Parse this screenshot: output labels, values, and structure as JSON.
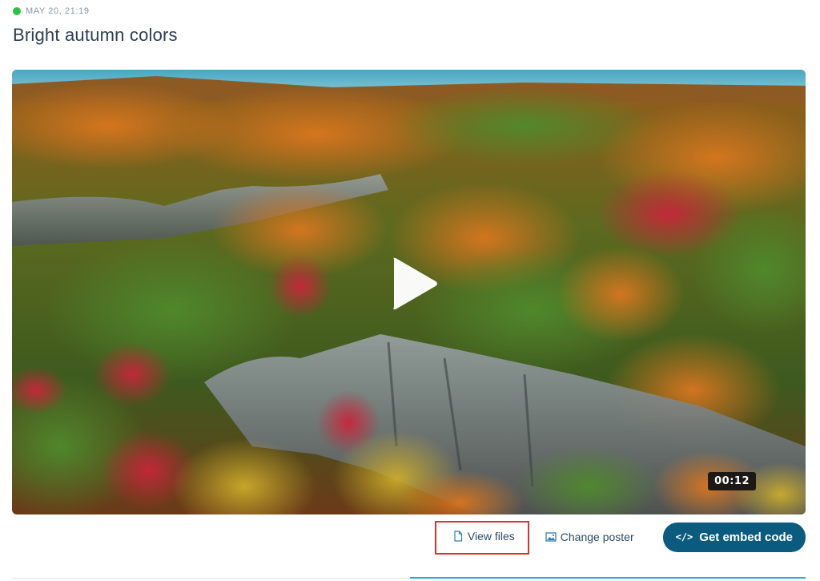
{
  "post": {
    "timestamp": "MAY 20, 21:19",
    "status_color": "#2bc33e",
    "title": "Bright autumn colors"
  },
  "video": {
    "duration": "00:12",
    "play_icon": "play-icon"
  },
  "actions": {
    "view_files_label": "View files",
    "view_files_icon": "file-icon",
    "change_poster_label": "Change poster",
    "change_poster_icon": "image-icon",
    "embed_label": "Get embed code",
    "embed_icon": "</>",
    "embed_color": "#0b5b7f",
    "highlight_color": "#d6332f"
  }
}
